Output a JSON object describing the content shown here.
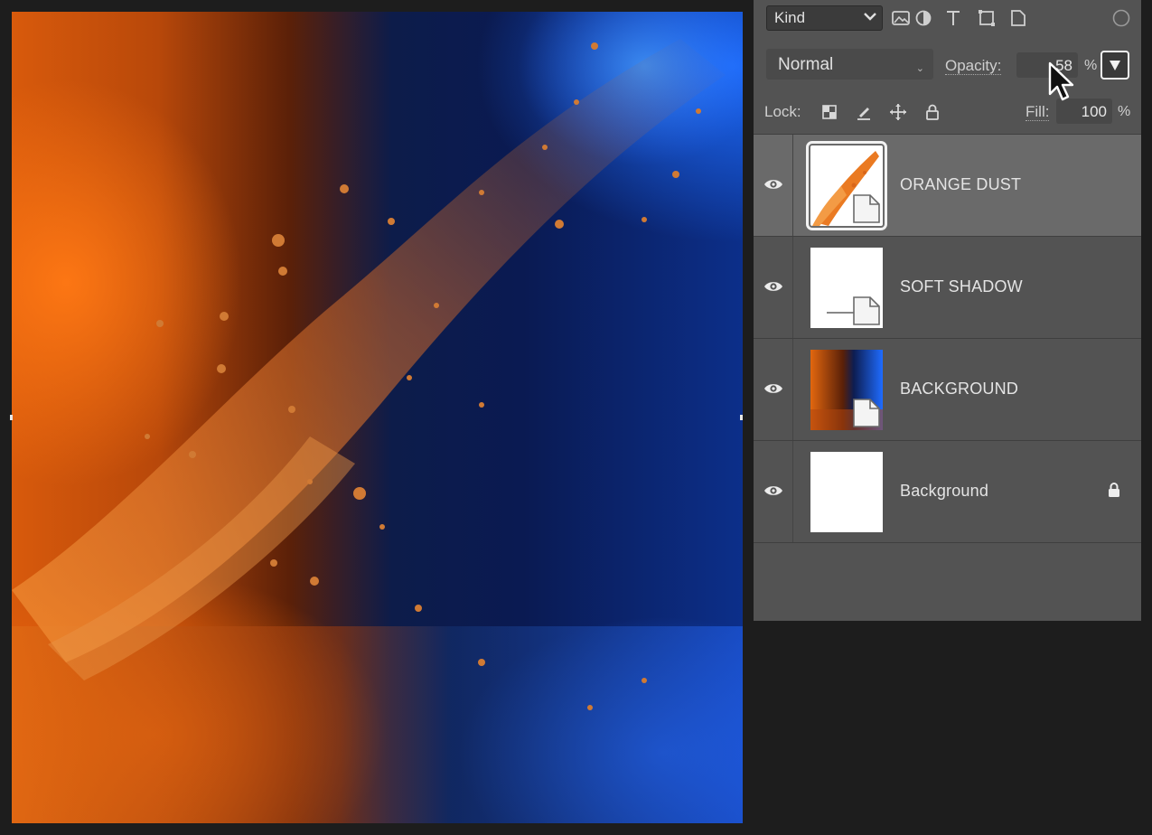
{
  "panel": {
    "filter": {
      "kind_label": "Kind",
      "icons": [
        "image-filter-icon",
        "adjustment-filter-icon",
        "type-filter-icon",
        "shape-filter-icon",
        "smart-object-filter-icon",
        "filter-toggle-icon"
      ]
    },
    "blend": {
      "mode": "Normal",
      "opacity_label": "Opacity:",
      "opacity_value": "58",
      "percent": "%"
    },
    "lock": {
      "label": "Lock:",
      "icons": [
        "lock-transparent-pixels-icon",
        "lock-image-pixels-icon",
        "lock-position-icon",
        "lock-all-icon"
      ],
      "fill_label": "Fill:",
      "fill_value": "100",
      "percent": "%"
    },
    "layers": [
      {
        "name": "ORANGE DUST",
        "selected": true,
        "visible": true,
        "thumb": "orange-dust",
        "smart_object": true,
        "locked": false
      },
      {
        "name": "SOFT SHADOW",
        "selected": false,
        "visible": true,
        "thumb": "transparent-shadow",
        "smart_object": true,
        "locked": false
      },
      {
        "name": "BACKGROUND",
        "selected": false,
        "visible": true,
        "thumb": "orange-blue-scene",
        "smart_object": true,
        "locked": false
      },
      {
        "name": "Background",
        "selected": false,
        "visible": true,
        "thumb": "white",
        "smart_object": false,
        "locked": true
      }
    ]
  },
  "colors": {
    "panel_bg": "#535353",
    "selected_row": "#6a6a6a",
    "app_bg": "#1d1d1d",
    "orange": "#e2670f",
    "blue": "#1f6cff"
  }
}
